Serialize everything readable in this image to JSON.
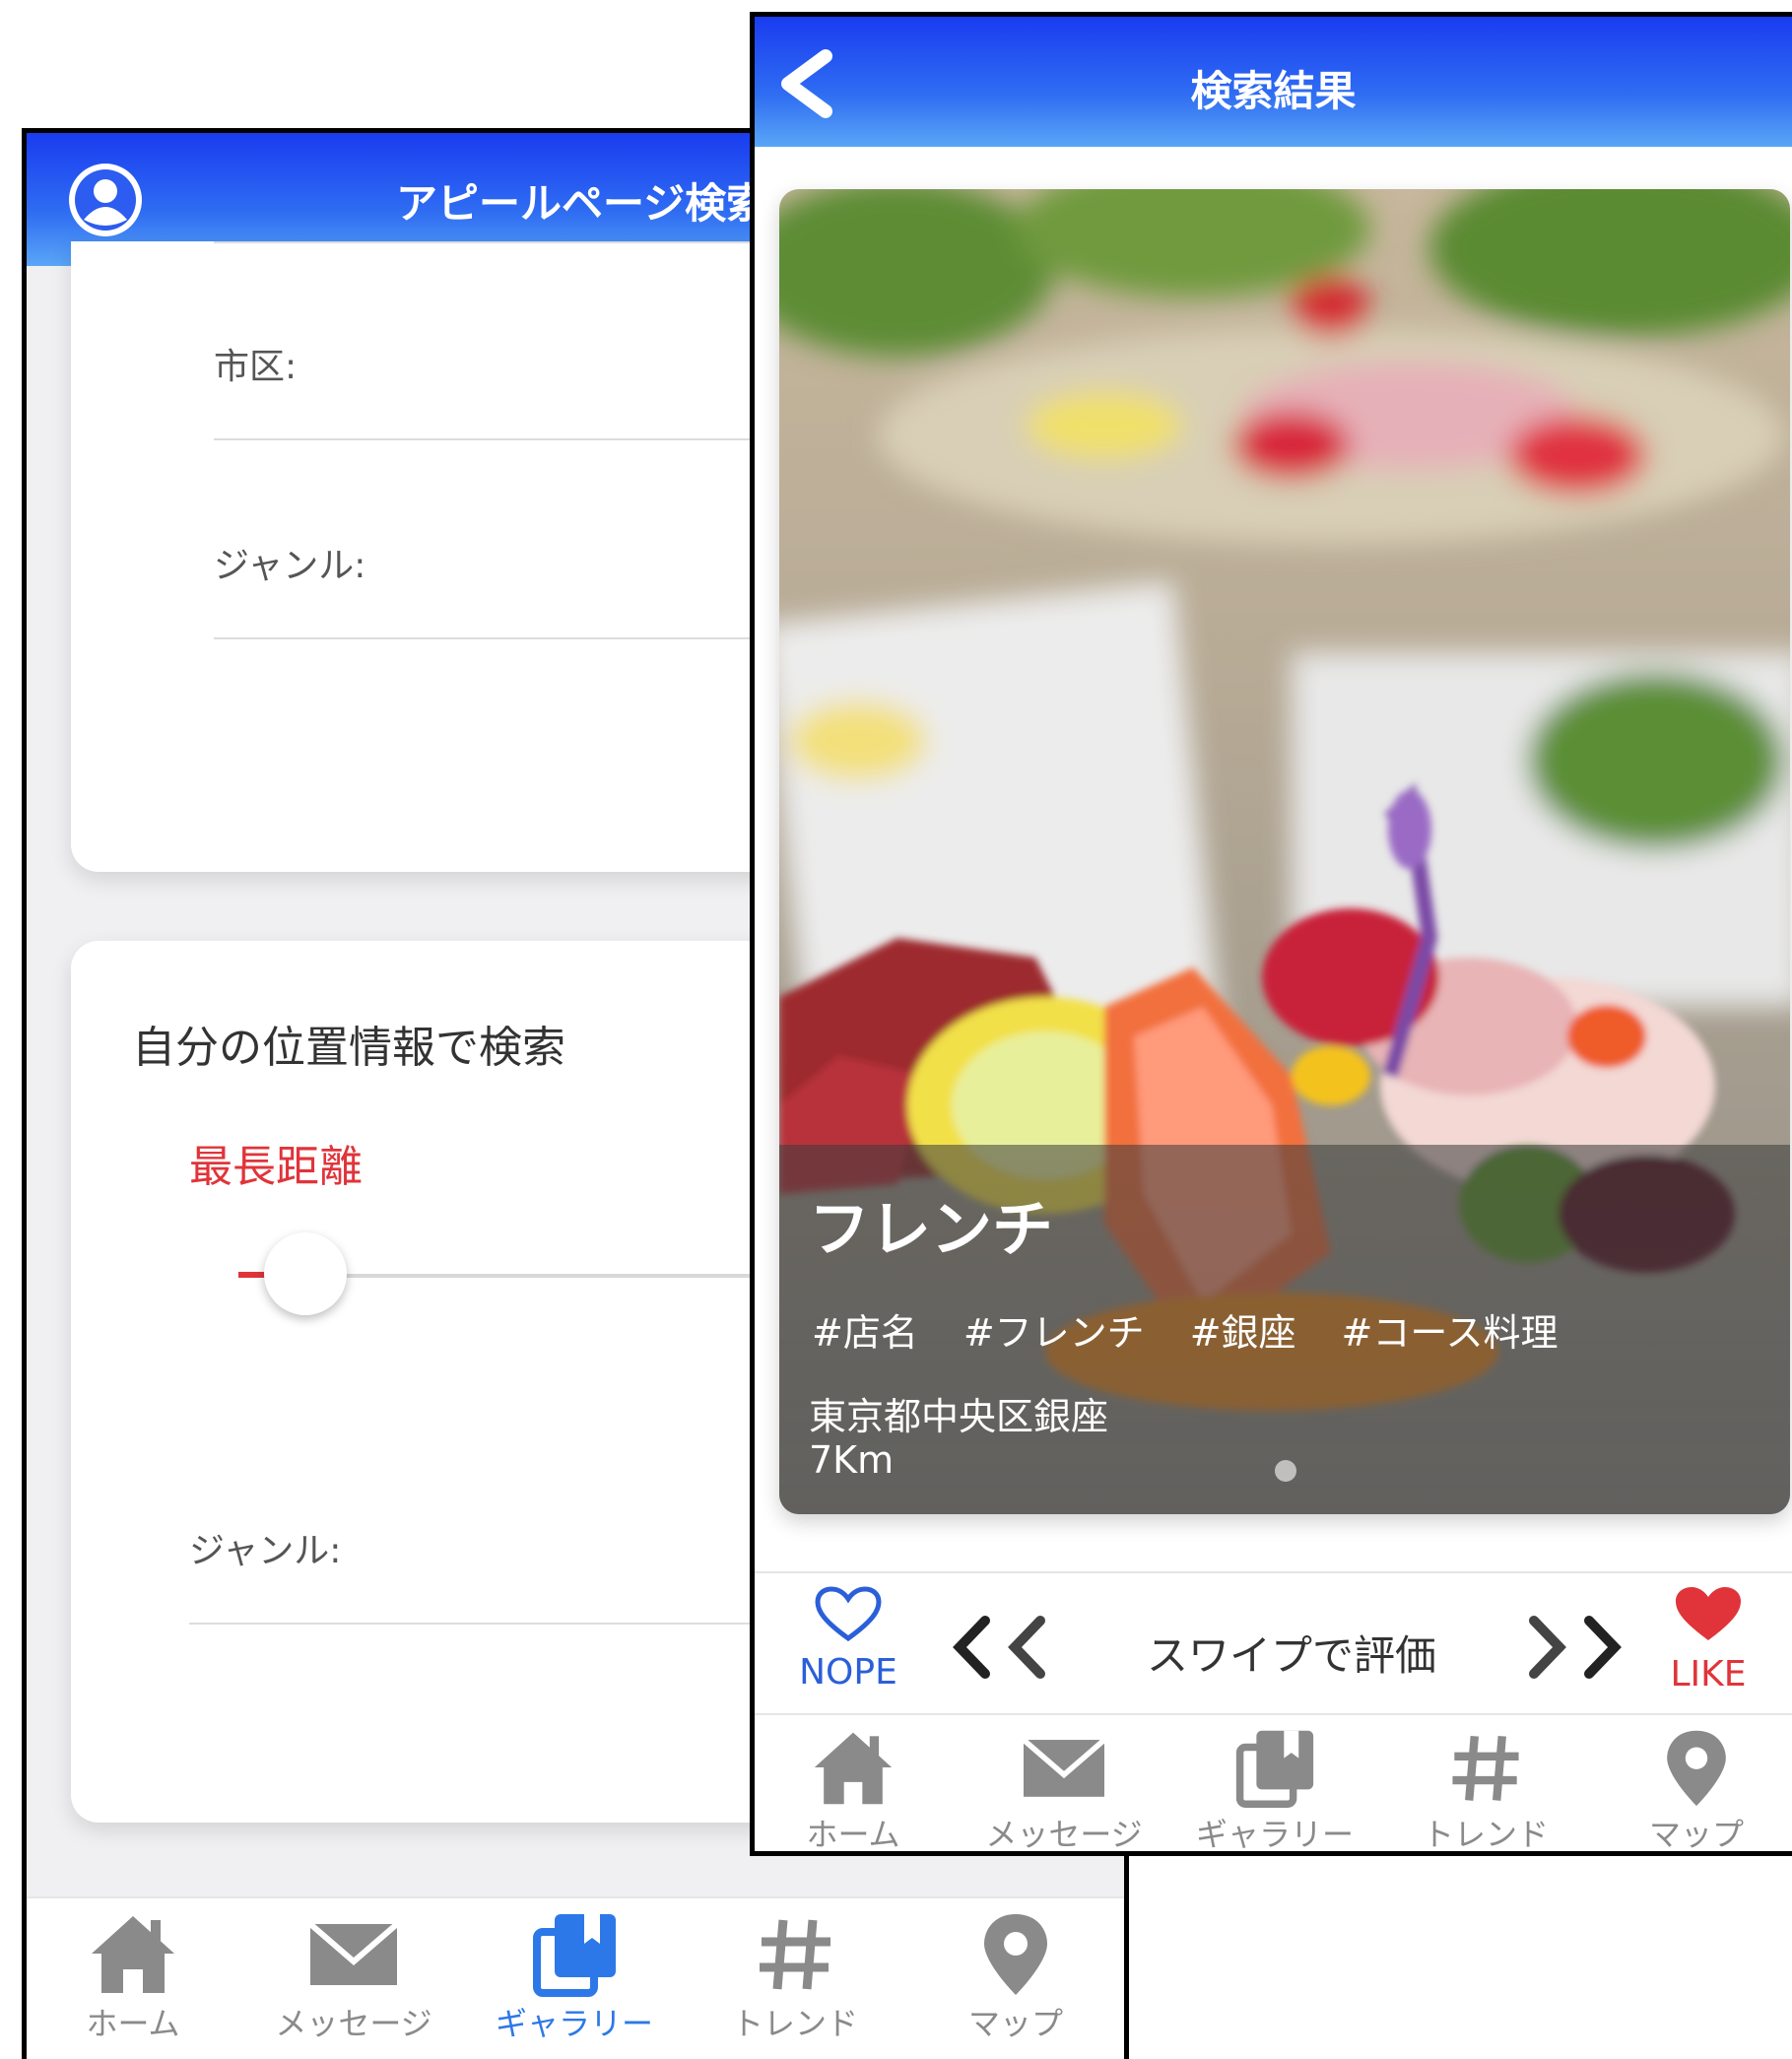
{
  "left_screen": {
    "title": "アピールページ検索",
    "fields": {
      "city_label": "市区:",
      "genre_label": "ジャンル:"
    },
    "location_section": {
      "title": "自分の位置情報で検索",
      "max_distance_label": "最長距離",
      "slider_value": 0.02,
      "genre_label": "ジャンル:"
    },
    "tabbar": [
      {
        "label": "ホーム",
        "icon": "home-icon"
      },
      {
        "label": "メッセージ",
        "icon": "mail-icon"
      },
      {
        "label": "ギャラリー",
        "icon": "gallery-icon",
        "active": true
      },
      {
        "label": "トレンド",
        "icon": "hashtag-icon"
      },
      {
        "label": "マップ",
        "icon": "map-pin-icon"
      }
    ]
  },
  "right_screen": {
    "title": "検索結果",
    "card": {
      "title": "フレンチ",
      "tags": [
        "#店名",
        "#フレンチ",
        "#銀座",
        "#コース料理"
      ],
      "address": "東京都中央区銀座",
      "distance": "7Km"
    },
    "swipe": {
      "nope_label": "NOPE",
      "like_label": "LIKE",
      "hint": "スワイプで評価"
    },
    "tabbar": [
      {
        "label": "ホーム",
        "icon": "home-icon"
      },
      {
        "label": "メッセージ",
        "icon": "mail-icon"
      },
      {
        "label": "ギャラリー",
        "icon": "gallery-icon"
      },
      {
        "label": "トレンド",
        "icon": "hashtag-icon"
      },
      {
        "label": "マップ",
        "icon": "map-pin-icon"
      }
    ]
  },
  "colors": {
    "header_gradient_top": "#1a3cf0",
    "header_gradient_bottom": "#5aa6f7",
    "accent_red": "#e0343a",
    "active_tab_blue": "#2d78e8",
    "inactive_tab_gray": "#8a8a8a"
  }
}
